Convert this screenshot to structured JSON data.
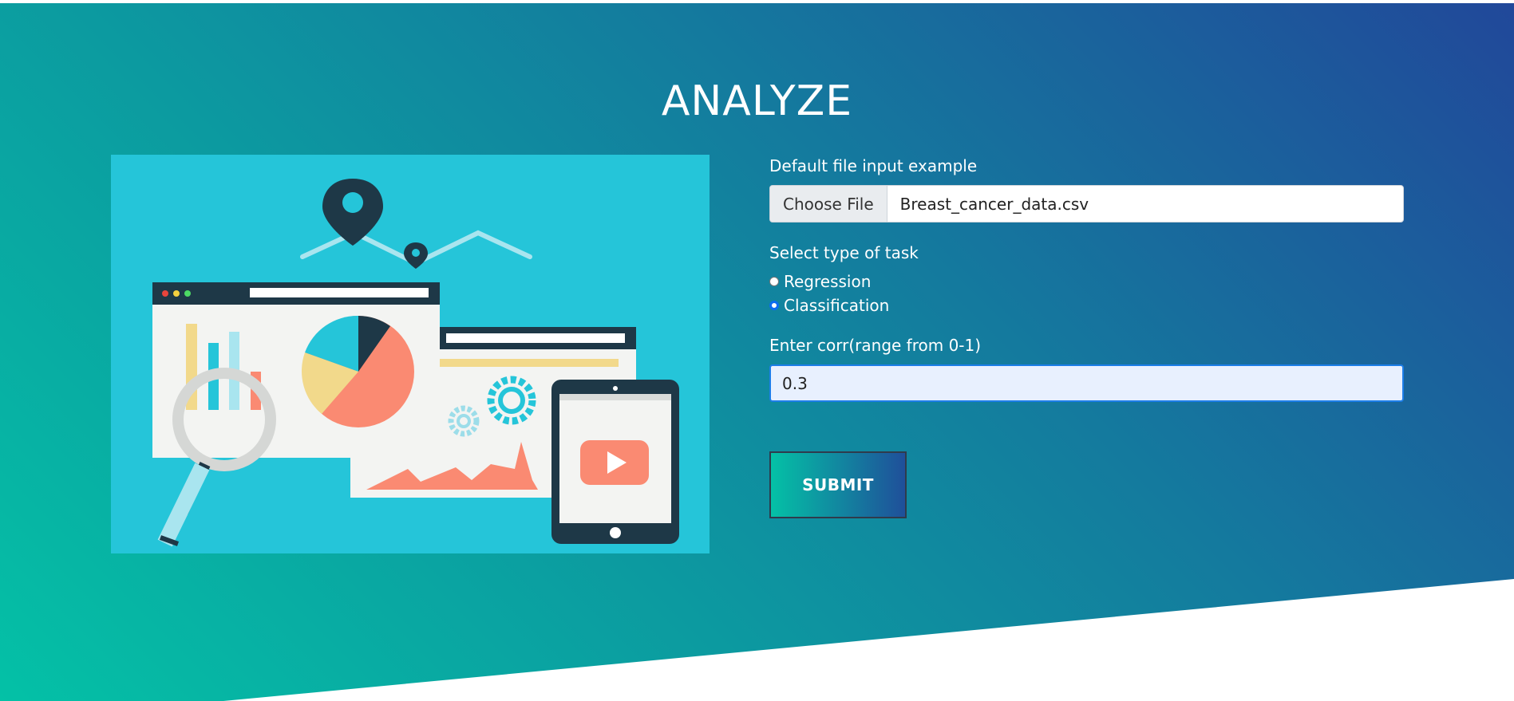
{
  "page": {
    "title": "ANALYZE"
  },
  "form": {
    "file_label": "Default file input example",
    "choose_file_label": "Choose File",
    "file_name": "Breast_cancer_data.csv",
    "task_label": "Select type of task",
    "task_options": [
      {
        "label": "Regression",
        "checked": false
      },
      {
        "label": "Classification",
        "checked": true
      }
    ],
    "corr_label": "Enter corr(range from 0-1)",
    "corr_value": "0.3",
    "submit_label": "SUBMIT"
  },
  "illustration": {
    "icon": "analytics-dashboard-illustration"
  },
  "colors": {
    "gradient_start": "#04c1a6",
    "gradient_end": "#21489a",
    "illustration_bg": "#25c5d9",
    "accent_salmon": "#fa8a72",
    "accent_dark": "#1e3847",
    "radio_checked": "#0b6cf0"
  }
}
